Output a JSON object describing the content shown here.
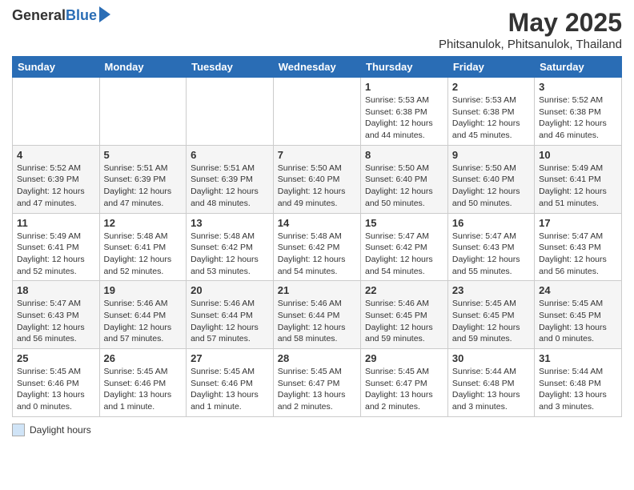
{
  "header": {
    "logo_general": "General",
    "logo_blue": "Blue",
    "title": "May 2025",
    "subtitle": "Phitsanulok, Phitsanulok, Thailand"
  },
  "days_of_week": [
    "Sunday",
    "Monday",
    "Tuesday",
    "Wednesday",
    "Thursday",
    "Friday",
    "Saturday"
  ],
  "weeks": [
    [
      {
        "num": "",
        "detail": ""
      },
      {
        "num": "",
        "detail": ""
      },
      {
        "num": "",
        "detail": ""
      },
      {
        "num": "",
        "detail": ""
      },
      {
        "num": "1",
        "detail": "Sunrise: 5:53 AM\nSunset: 6:38 PM\nDaylight: 12 hours\nand 44 minutes."
      },
      {
        "num": "2",
        "detail": "Sunrise: 5:53 AM\nSunset: 6:38 PM\nDaylight: 12 hours\nand 45 minutes."
      },
      {
        "num": "3",
        "detail": "Sunrise: 5:52 AM\nSunset: 6:38 PM\nDaylight: 12 hours\nand 46 minutes."
      }
    ],
    [
      {
        "num": "4",
        "detail": "Sunrise: 5:52 AM\nSunset: 6:39 PM\nDaylight: 12 hours\nand 47 minutes."
      },
      {
        "num": "5",
        "detail": "Sunrise: 5:51 AM\nSunset: 6:39 PM\nDaylight: 12 hours\nand 47 minutes."
      },
      {
        "num": "6",
        "detail": "Sunrise: 5:51 AM\nSunset: 6:39 PM\nDaylight: 12 hours\nand 48 minutes."
      },
      {
        "num": "7",
        "detail": "Sunrise: 5:50 AM\nSunset: 6:40 PM\nDaylight: 12 hours\nand 49 minutes."
      },
      {
        "num": "8",
        "detail": "Sunrise: 5:50 AM\nSunset: 6:40 PM\nDaylight: 12 hours\nand 50 minutes."
      },
      {
        "num": "9",
        "detail": "Sunrise: 5:50 AM\nSunset: 6:40 PM\nDaylight: 12 hours\nand 50 minutes."
      },
      {
        "num": "10",
        "detail": "Sunrise: 5:49 AM\nSunset: 6:41 PM\nDaylight: 12 hours\nand 51 minutes."
      }
    ],
    [
      {
        "num": "11",
        "detail": "Sunrise: 5:49 AM\nSunset: 6:41 PM\nDaylight: 12 hours\nand 52 minutes."
      },
      {
        "num": "12",
        "detail": "Sunrise: 5:48 AM\nSunset: 6:41 PM\nDaylight: 12 hours\nand 52 minutes."
      },
      {
        "num": "13",
        "detail": "Sunrise: 5:48 AM\nSunset: 6:42 PM\nDaylight: 12 hours\nand 53 minutes."
      },
      {
        "num": "14",
        "detail": "Sunrise: 5:48 AM\nSunset: 6:42 PM\nDaylight: 12 hours\nand 54 minutes."
      },
      {
        "num": "15",
        "detail": "Sunrise: 5:47 AM\nSunset: 6:42 PM\nDaylight: 12 hours\nand 54 minutes."
      },
      {
        "num": "16",
        "detail": "Sunrise: 5:47 AM\nSunset: 6:43 PM\nDaylight: 12 hours\nand 55 minutes."
      },
      {
        "num": "17",
        "detail": "Sunrise: 5:47 AM\nSunset: 6:43 PM\nDaylight: 12 hours\nand 56 minutes."
      }
    ],
    [
      {
        "num": "18",
        "detail": "Sunrise: 5:47 AM\nSunset: 6:43 PM\nDaylight: 12 hours\nand 56 minutes."
      },
      {
        "num": "19",
        "detail": "Sunrise: 5:46 AM\nSunset: 6:44 PM\nDaylight: 12 hours\nand 57 minutes."
      },
      {
        "num": "20",
        "detail": "Sunrise: 5:46 AM\nSunset: 6:44 PM\nDaylight: 12 hours\nand 57 minutes."
      },
      {
        "num": "21",
        "detail": "Sunrise: 5:46 AM\nSunset: 6:44 PM\nDaylight: 12 hours\nand 58 minutes."
      },
      {
        "num": "22",
        "detail": "Sunrise: 5:46 AM\nSunset: 6:45 PM\nDaylight: 12 hours\nand 59 minutes."
      },
      {
        "num": "23",
        "detail": "Sunrise: 5:45 AM\nSunset: 6:45 PM\nDaylight: 12 hours\nand 59 minutes."
      },
      {
        "num": "24",
        "detail": "Sunrise: 5:45 AM\nSunset: 6:45 PM\nDaylight: 13 hours\nand 0 minutes."
      }
    ],
    [
      {
        "num": "25",
        "detail": "Sunrise: 5:45 AM\nSunset: 6:46 PM\nDaylight: 13 hours\nand 0 minutes."
      },
      {
        "num": "26",
        "detail": "Sunrise: 5:45 AM\nSunset: 6:46 PM\nDaylight: 13 hours\nand 1 minute."
      },
      {
        "num": "27",
        "detail": "Sunrise: 5:45 AM\nSunset: 6:46 PM\nDaylight: 13 hours\nand 1 minute."
      },
      {
        "num": "28",
        "detail": "Sunrise: 5:45 AM\nSunset: 6:47 PM\nDaylight: 13 hours\nand 2 minutes."
      },
      {
        "num": "29",
        "detail": "Sunrise: 5:45 AM\nSunset: 6:47 PM\nDaylight: 13 hours\nand 2 minutes."
      },
      {
        "num": "30",
        "detail": "Sunrise: 5:44 AM\nSunset: 6:48 PM\nDaylight: 13 hours\nand 3 minutes."
      },
      {
        "num": "31",
        "detail": "Sunrise: 5:44 AM\nSunset: 6:48 PM\nDaylight: 13 hours\nand 3 minutes."
      }
    ]
  ],
  "legend": {
    "box_label": "Daylight hours"
  }
}
